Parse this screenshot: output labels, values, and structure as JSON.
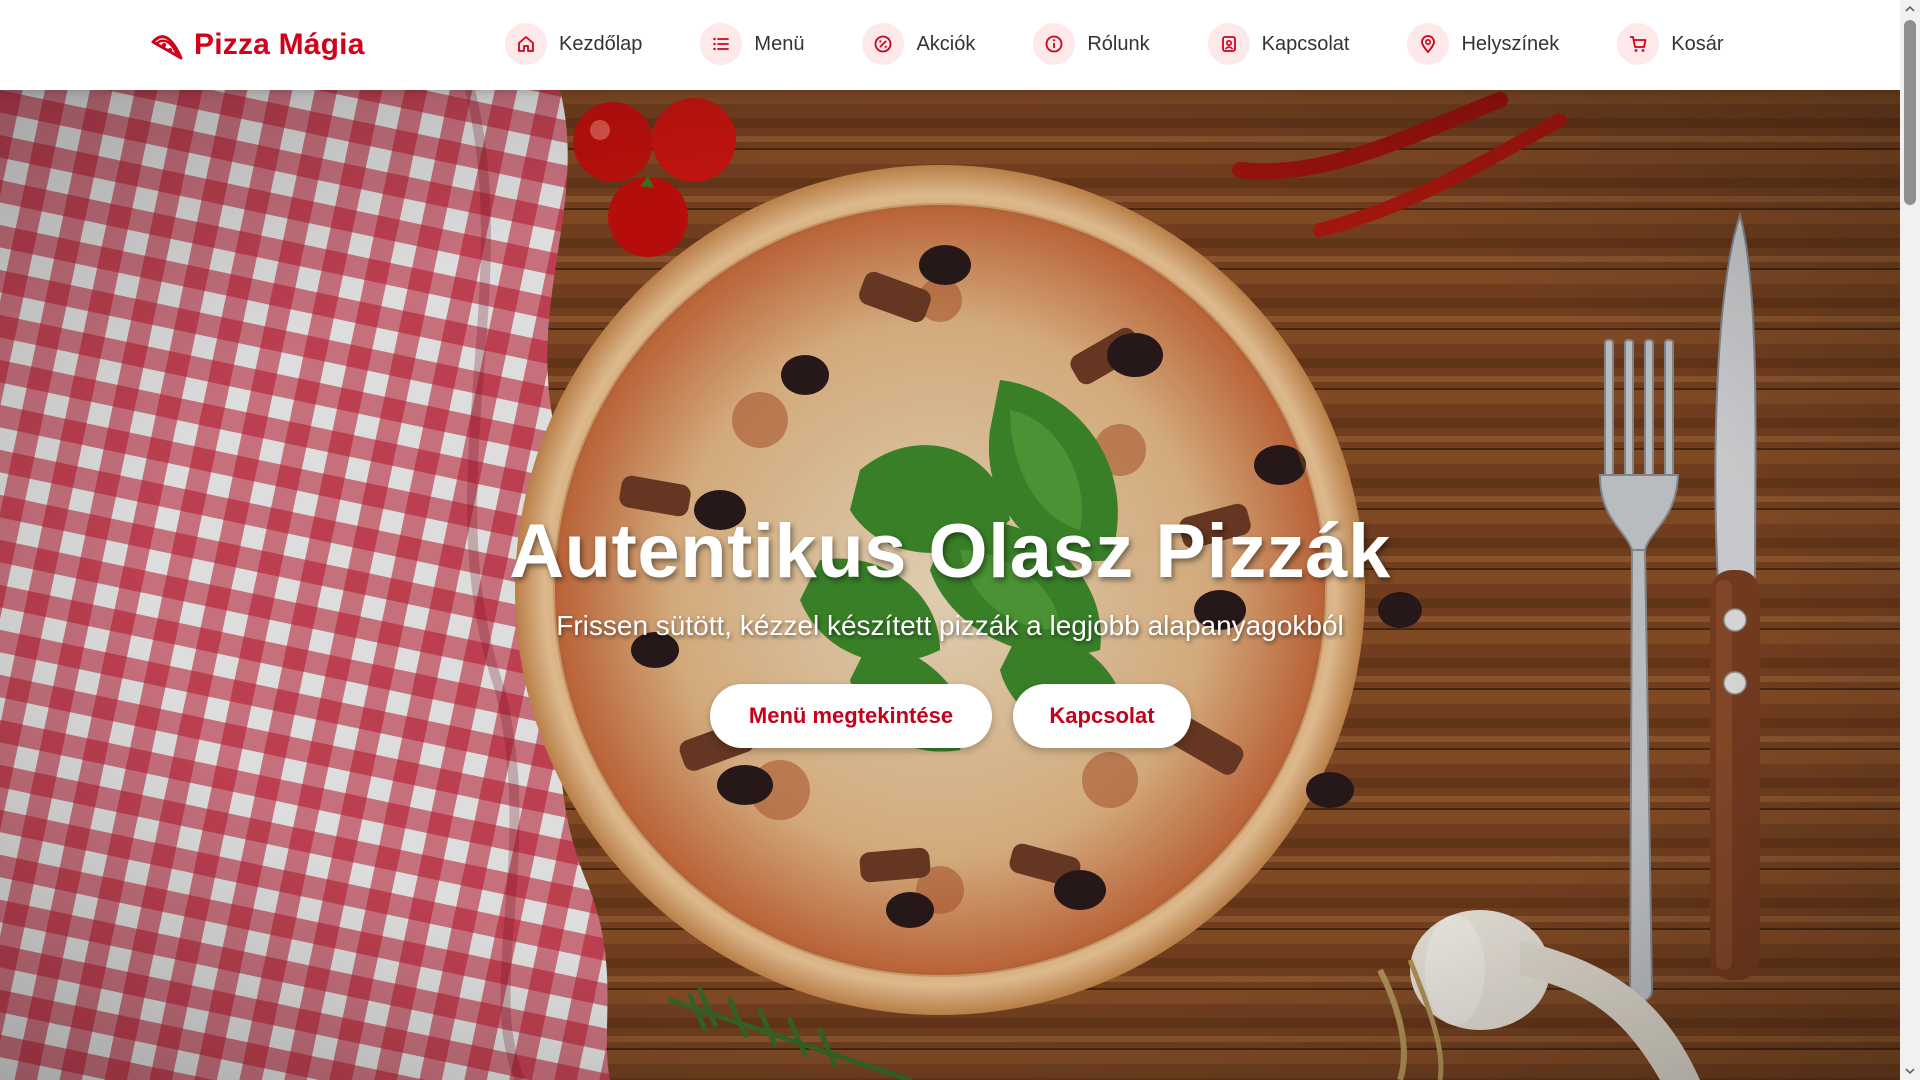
{
  "header": {
    "brand": "Pizza Mágia",
    "nav": [
      {
        "label": "Kezdőlap",
        "icon": "home-icon"
      },
      {
        "label": "Menü",
        "icon": "list-icon"
      },
      {
        "label": "Akciók",
        "icon": "discount-icon"
      },
      {
        "label": "Rólunk",
        "icon": "info-icon"
      },
      {
        "label": "Kapcsolat",
        "icon": "contact-icon"
      },
      {
        "label": "Helyszínek",
        "icon": "location-pin-icon"
      },
      {
        "label": "Kosár",
        "icon": "cart-icon"
      }
    ]
  },
  "hero": {
    "title": "Autentikus Olasz Pizzák",
    "subtitle": "Frissen sütött, kézzel készített pizzák a legjobb alapanyagokból",
    "buttons": {
      "menu": "Menü megtekintése",
      "contact": "Kapcsolat"
    }
  },
  "colors": {
    "brand": "#d0021b",
    "icon_bg": "#fde8ea",
    "nav_text": "#333333",
    "button_text": "#c4001a"
  }
}
